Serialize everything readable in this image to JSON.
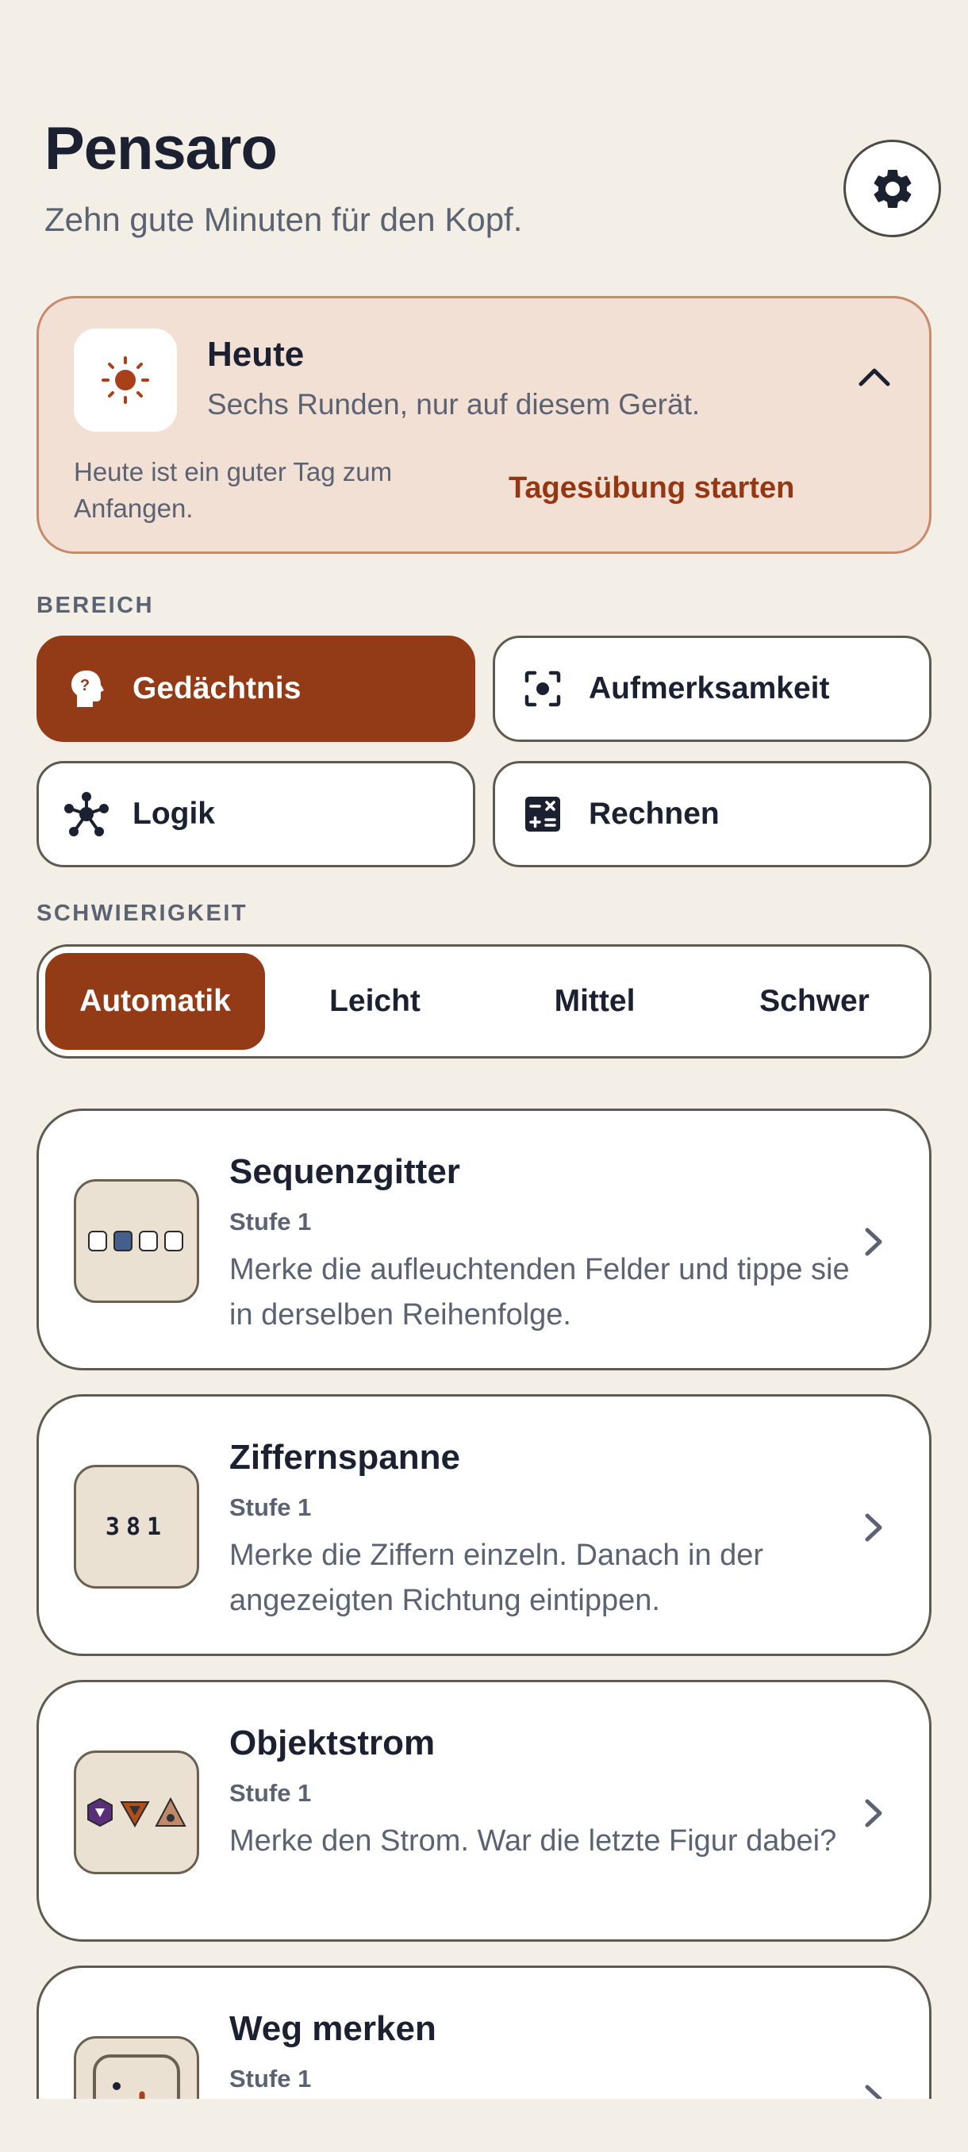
{
  "app": {
    "title": "Pensaro",
    "subtitle": "Zehn gute Minuten für den Kopf."
  },
  "settings": {
    "icon": "gear-icon"
  },
  "today": {
    "icon": "sun-icon",
    "title": "Heute",
    "subtitle": "Sechs Runden, nur auf diesem Gerät.",
    "note": "Heute ist ein guter Tag zum Anfangen.",
    "start_label": "Tagesübung starten",
    "expanded": true
  },
  "areas": {
    "label": "BEREICH",
    "items": [
      {
        "label": "Gedächtnis",
        "icon": "head-question-icon",
        "selected": true
      },
      {
        "label": "Aufmerksamkeit",
        "icon": "focus-icon",
        "selected": false
      },
      {
        "label": "Logik",
        "icon": "hub-icon",
        "selected": false
      },
      {
        "label": "Rechnen",
        "icon": "calculator-icon",
        "selected": false
      }
    ]
  },
  "difficulty": {
    "label": "SCHWIERIGKEIT",
    "options": [
      "Automatik",
      "Leicht",
      "Mittel",
      "Schwer"
    ],
    "selected": "Automatik"
  },
  "games": [
    {
      "title": "Sequenzgitter",
      "level": "Stufe 1",
      "description": "Merke die aufleuchtenden Felder und tippe sie in derselben Reihenfolge.",
      "icon": "grid-sequence-icon"
    },
    {
      "title": "Ziffernspanne",
      "level": "Stufe 1",
      "description": "Merke die Ziffern einzeln. Danach in der angezeigten Richtung eintippen.",
      "icon": "digits-icon",
      "thumb_text": "381"
    },
    {
      "title": "Objektstrom",
      "level": "Stufe 1",
      "description": "Merke den Strom. War die letzte Figur dabei?",
      "icon": "shapes-icon"
    },
    {
      "title": "Weg merken",
      "level": "Stufe 1",
      "description": "",
      "icon": "path-icon"
    }
  ],
  "colors": {
    "accent": "#933a16",
    "background": "#f3efe6",
    "today_bg": "#f3e0d5"
  }
}
